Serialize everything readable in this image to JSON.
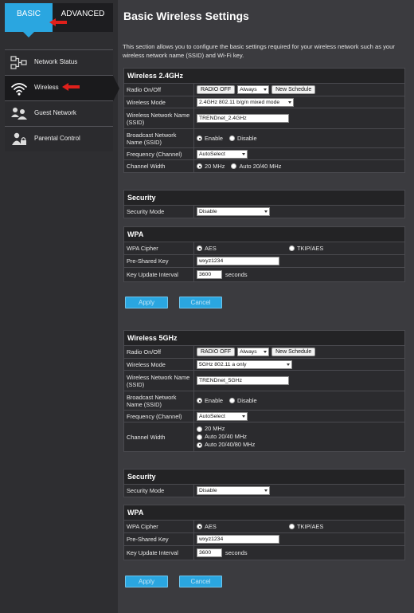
{
  "tabs": {
    "basic": "BASIC",
    "advanced": "ADVANCED"
  },
  "nav": [
    {
      "label": "Network Status",
      "icon": "network-status-icon"
    },
    {
      "label": "Wireless",
      "icon": "wifi-icon"
    },
    {
      "label": "Guest Network",
      "icon": "guest-network-icon"
    },
    {
      "label": "Parental Control",
      "icon": "parental-control-icon"
    }
  ],
  "colors": {
    "accent": "#2aa6e0",
    "arrow": "#e0201b",
    "background": "#3b3b3f",
    "panel": "#2b2b2e"
  },
  "page": {
    "title": "Basic Wireless Settings",
    "intro": "This section allows you to configure the basic settings required for your wireless network such as your wireless network name (SSID) and Wi-Fi key."
  },
  "w24": {
    "title": "Wireless 2.4GHz",
    "radio_label": "Radio On/Off",
    "radio_btn": "RADIO OFF",
    "schedule_value": "Always",
    "new_schedule": "New Schedule",
    "mode_label": "Wireless Mode",
    "mode_value": "2.4GHz 802.11 b/g/n mixed mode",
    "ssid_label": "Wireless Network Name (SSID)",
    "ssid_value": "TRENDnet_2.4GHz",
    "broadcast_label": "Broadcast Network Name (SSID)",
    "enable": "Enable",
    "disable": "Disable",
    "freq_label": "Frequency (Channel)",
    "freq_value": "AutoSelect",
    "width_label": "Channel Width",
    "width_opt1": "20 MHz",
    "width_opt2": "Auto 20/40 MHz"
  },
  "sec24": {
    "title": "Security",
    "mode_label": "Security Mode",
    "mode_value": "Disable"
  },
  "wpa24": {
    "title": "WPA",
    "cipher_label": "WPA Cipher",
    "aes": "AES",
    "tkip": "TKIP/AES",
    "psk_label": "Pre-Shared Key",
    "psk_value": "wxyz1234",
    "interval_label": "Key Update Interval",
    "interval_value": "3600",
    "interval_unit": "seconds"
  },
  "buttons": {
    "apply": "Apply",
    "cancel": "Cancel"
  },
  "w5": {
    "title": "Wireless 5GHz",
    "radio_label": "Radio On/Off",
    "radio_btn": "RADIO OFF",
    "schedule_value": "Always",
    "new_schedule": "New Schedule",
    "mode_label": "Wireless Mode",
    "mode_value": "5GHz 802.11 a only",
    "ssid_label": "Wireless Network Name (SSID)",
    "ssid_value": "TRENDnet_5GHz",
    "broadcast_label": "Broadcast Network Name (SSID)",
    "enable": "Enable",
    "disable": "Disable",
    "freq_label": "Frequency (Channel)",
    "freq_value": "AutoSelect",
    "width_label": "Channel Width",
    "width_opt1": "20 MHz",
    "width_opt2": "Auto 20/40 MHz",
    "width_opt3": "Auto 20/40/80 MHz"
  },
  "sec5": {
    "title": "Security",
    "mode_label": "Security Mode",
    "mode_value": "Disable"
  },
  "wpa5": {
    "title": "WPA",
    "cipher_label": "WPA Cipher",
    "aes": "AES",
    "tkip": "TKIP/AES",
    "psk_label": "Pre-Shared Key",
    "psk_value": "wxyz1234",
    "interval_label": "Key Update Interval",
    "interval_value": "3600",
    "interval_unit": "seconds"
  }
}
